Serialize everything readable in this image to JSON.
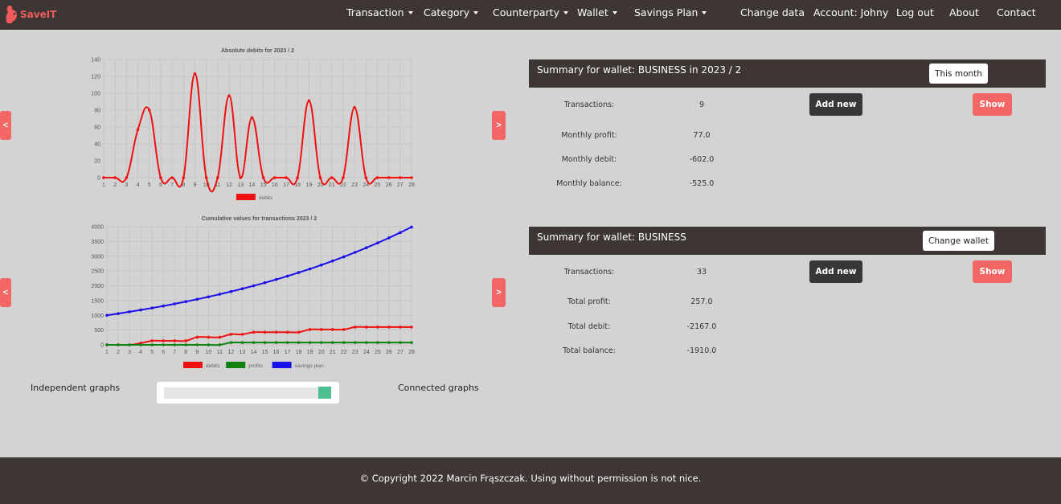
{
  "app": {
    "logo_text": "SaveIT"
  },
  "nav": {
    "menus": [
      "Transaction",
      "Category",
      "Counterparty",
      "Wallet",
      "Savings Plan"
    ],
    "links": [
      "Change data",
      "Account: Johny",
      "Log out",
      "About",
      "Contact"
    ]
  },
  "arrows": {
    "prev": "<",
    "next": ">"
  },
  "colors": {
    "debits": "#ee1111",
    "profits": "#108010",
    "savings_plan": "#1a10e8",
    "accent": "#f26666",
    "dark": "#3e3535"
  },
  "chart_data": [
    {
      "type": "line",
      "title": "Absolute debits for 2023 / 2",
      "categories": [
        "1",
        "2",
        "3",
        "4",
        "5",
        "6",
        "7",
        "8",
        "9",
        "10",
        "11",
        "12",
        "13",
        "14",
        "15",
        "16",
        "17",
        "18",
        "19",
        "20",
        "21",
        "22",
        "23",
        "24",
        "25",
        "26",
        "27",
        "28"
      ],
      "yticks": [
        "0",
        "20",
        "40",
        "60",
        "80",
        "100",
        "120",
        "140"
      ],
      "ylim": [
        0,
        140
      ],
      "series": [
        {
          "name": "debits",
          "color": "#ee1111",
          "values": [
            0,
            0,
            0,
            57,
            80,
            0,
            0,
            0,
            123,
            0,
            0,
            97,
            0,
            71,
            0,
            0,
            0,
            0,
            91,
            0,
            0,
            0,
            83,
            0,
            0,
            0,
            0,
            0
          ]
        }
      ],
      "legend": "bottom"
    },
    {
      "type": "line",
      "title": "Cumulative values for transactions 2023 / 2",
      "categories": [
        "1",
        "2",
        "3",
        "4",
        "5",
        "6",
        "7",
        "8",
        "9",
        "10",
        "11",
        "12",
        "13",
        "14",
        "15",
        "16",
        "17",
        "18",
        "19",
        "20",
        "21",
        "22",
        "23",
        "24",
        "25",
        "26",
        "27",
        "28"
      ],
      "yticks": [
        "0",
        "500",
        "1000",
        "1500",
        "2000",
        "2500",
        "3000",
        "3500",
        "4000"
      ],
      "ylim": [
        0,
        4000
      ],
      "series": [
        {
          "name": "debits",
          "color": "#ee1111",
          "values": [
            0,
            0,
            0,
            57,
            137,
            137,
            137,
            137,
            260,
            260,
            260,
            357,
            357,
            428,
            428,
            428,
            428,
            428,
            519,
            519,
            519,
            519,
            602,
            602,
            602,
            602,
            602,
            602
          ]
        },
        {
          "name": "profits",
          "color": "#108010",
          "values": [
            0,
            0,
            0,
            0,
            0,
            0,
            0,
            0,
            0,
            0,
            0,
            77,
            77,
            77,
            77,
            77,
            77,
            77,
            77,
            77,
            77,
            77,
            77,
            77,
            77,
            77,
            77,
            77
          ]
        },
        {
          "name": "savings plan",
          "color": "#1a10e8",
          "values": [
            1000,
            1058,
            1118,
            1181,
            1247,
            1316,
            1388,
            1464,
            1543,
            1626,
            1713,
            1804,
            1899,
            1999,
            2103,
            2212,
            2326,
            2446,
            2571,
            2702,
            2838,
            2981,
            3131,
            3288,
            3451,
            3622,
            3801,
            3988
          ]
        }
      ],
      "legend": "bottom"
    }
  ],
  "slider": {
    "left_label": "Independent graphs",
    "right_label": "Connected graphs",
    "value": 1
  },
  "summary_month": {
    "title": "Summary for wallet: BUSINESS in 2023 / 2",
    "button": "This month",
    "transactions_label": "Transactions:",
    "transactions_value": "9",
    "add_button": "Add new",
    "show_button": "Show",
    "rows": [
      {
        "label": "Monthly profit:",
        "value": "77.0"
      },
      {
        "label": "Monthly debit:",
        "value": "-602.0"
      },
      {
        "label": "Monthly balance:",
        "value": "-525.0"
      }
    ]
  },
  "summary_total": {
    "title": "Summary for wallet: BUSINESS",
    "button": "Change wallet",
    "transactions_label": "Transactions:",
    "transactions_value": "33",
    "add_button": "Add new",
    "show_button": "Show",
    "rows": [
      {
        "label": "Total profit:",
        "value": "257.0"
      },
      {
        "label": "Total debit:",
        "value": "-2167.0"
      },
      {
        "label": "Total balance:",
        "value": "-1910.0"
      }
    ]
  },
  "footer": {
    "text": "© Copyright 2022 Marcin Frąszczak. Using without permission is not nice."
  }
}
